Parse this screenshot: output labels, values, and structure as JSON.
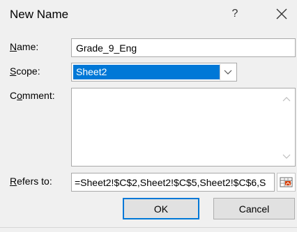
{
  "window": {
    "title": "New Name",
    "help_glyph": "?"
  },
  "fields": {
    "name": {
      "label_underlined": "N",
      "label_rest": "ame:",
      "value": "Grade_9_Eng"
    },
    "scope": {
      "label_underlined": "S",
      "label_rest": "cope:",
      "value": "Sheet2"
    },
    "comment": {
      "label_pre": "C",
      "label_underlined": "o",
      "label_rest": "mment:",
      "value": ""
    },
    "refers_to": {
      "label_underlined": "R",
      "label_rest": "efers to:",
      "value": "=Sheet2!$C$2,Sheet2!$C$5,Sheet2!$C$6,S"
    }
  },
  "buttons": {
    "ok": "OK",
    "cancel": "Cancel"
  },
  "icons": {
    "close": "close-icon",
    "dropdown": "chevron-down-icon",
    "scroll_up": "scroll-up-icon",
    "scroll_down": "scroll-down-icon",
    "collapse": "collapse-dialog-icon"
  },
  "colors": {
    "selection": "#0078d7",
    "dialog_bg": "#f0f0f0",
    "button_bg": "#e1e1e1",
    "default_button_border": "#0078d7"
  }
}
